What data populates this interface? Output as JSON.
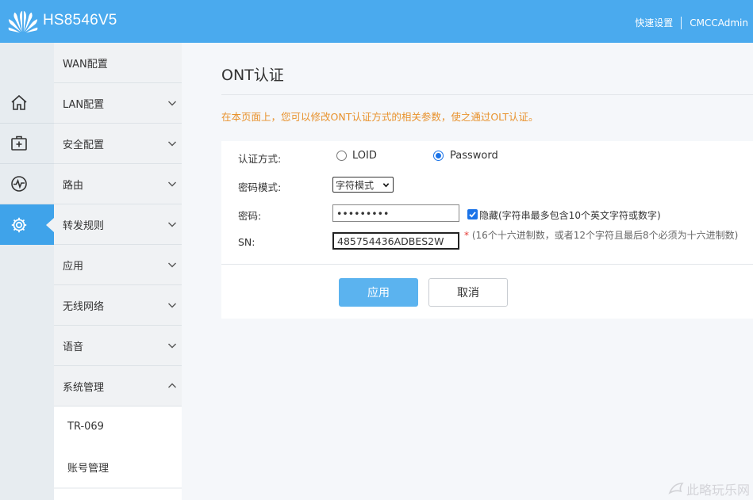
{
  "header": {
    "model": "HS8546V5",
    "quick_setup": "快速设置",
    "user": "CMCCAdmin",
    "bg_color": "#4aaaee"
  },
  "rail": {
    "items": [
      {
        "icon": "home-icon"
      },
      {
        "icon": "medical-kit-icon"
      },
      {
        "icon": "pulse-icon"
      },
      {
        "icon": "gear-icon",
        "active": true
      }
    ]
  },
  "menu": {
    "items": [
      {
        "label": "WAN配置"
      },
      {
        "label": "LAN配置"
      },
      {
        "label": "安全配置"
      },
      {
        "label": "路由"
      },
      {
        "label": "转发规则"
      },
      {
        "label": "应用"
      },
      {
        "label": "无线网络"
      },
      {
        "label": "语音"
      },
      {
        "label": "系统管理",
        "expanded": true
      }
    ],
    "sub_items": [
      {
        "label": "TR-069"
      },
      {
        "label": "账号管理"
      }
    ]
  },
  "main": {
    "title": "ONT认证",
    "description": "在本页面上，您可以修改ONT认证方式的相关参数，使之通过OLT认证。",
    "form": {
      "auth_mode_label": "认证方式:",
      "auth_options": [
        "LOID",
        "Password"
      ],
      "auth_selected": "Password",
      "pwd_mode_label": "密码模式:",
      "pwd_mode_value": "字符模式",
      "password_label": "密码:",
      "password_value": "•••••••••",
      "hide_checked": true,
      "hide_label": "隐藏(字符串最多包含10个英文字符或数字)",
      "sn_label": "SN:",
      "sn_value": "485754436ADBES2W",
      "sn_note_star": "*",
      "sn_note": "(16个十六进制数，或者12个字符且最后8个必须为十六进制数)"
    },
    "buttons": {
      "apply": "应用",
      "cancel": "取消"
    }
  },
  "watermark": "此略玩乐网"
}
